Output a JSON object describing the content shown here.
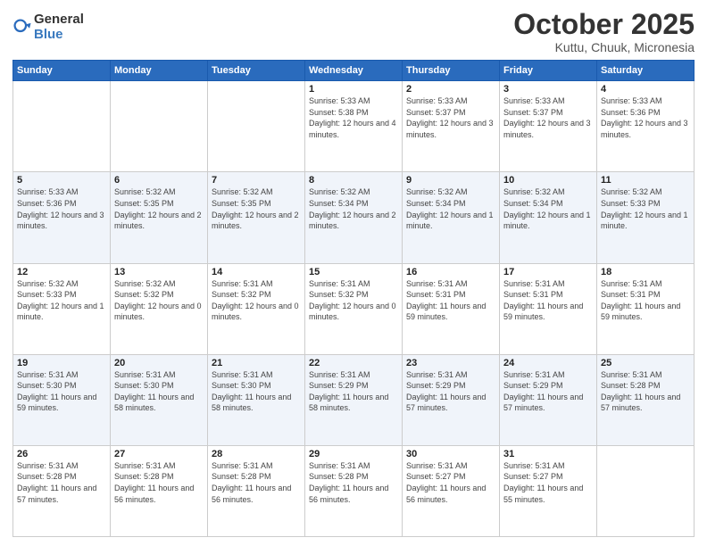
{
  "logo": {
    "general": "General",
    "blue": "Blue"
  },
  "header": {
    "month": "October 2025",
    "location": "Kuttu, Chuuk, Micronesia"
  },
  "weekdays": [
    "Sunday",
    "Monday",
    "Tuesday",
    "Wednesday",
    "Thursday",
    "Friday",
    "Saturday"
  ],
  "weeks": [
    [
      {
        "day": "",
        "sunrise": "",
        "sunset": "",
        "daylight": ""
      },
      {
        "day": "",
        "sunrise": "",
        "sunset": "",
        "daylight": ""
      },
      {
        "day": "",
        "sunrise": "",
        "sunset": "",
        "daylight": ""
      },
      {
        "day": "1",
        "sunrise": "Sunrise: 5:33 AM",
        "sunset": "Sunset: 5:38 PM",
        "daylight": "Daylight: 12 hours and 4 minutes."
      },
      {
        "day": "2",
        "sunrise": "Sunrise: 5:33 AM",
        "sunset": "Sunset: 5:37 PM",
        "daylight": "Daylight: 12 hours and 3 minutes."
      },
      {
        "day": "3",
        "sunrise": "Sunrise: 5:33 AM",
        "sunset": "Sunset: 5:37 PM",
        "daylight": "Daylight: 12 hours and 3 minutes."
      },
      {
        "day": "4",
        "sunrise": "Sunrise: 5:33 AM",
        "sunset": "Sunset: 5:36 PM",
        "daylight": "Daylight: 12 hours and 3 minutes."
      }
    ],
    [
      {
        "day": "5",
        "sunrise": "Sunrise: 5:33 AM",
        "sunset": "Sunset: 5:36 PM",
        "daylight": "Daylight: 12 hours and 3 minutes."
      },
      {
        "day": "6",
        "sunrise": "Sunrise: 5:32 AM",
        "sunset": "Sunset: 5:35 PM",
        "daylight": "Daylight: 12 hours and 2 minutes."
      },
      {
        "day": "7",
        "sunrise": "Sunrise: 5:32 AM",
        "sunset": "Sunset: 5:35 PM",
        "daylight": "Daylight: 12 hours and 2 minutes."
      },
      {
        "day": "8",
        "sunrise": "Sunrise: 5:32 AM",
        "sunset": "Sunset: 5:34 PM",
        "daylight": "Daylight: 12 hours and 2 minutes."
      },
      {
        "day": "9",
        "sunrise": "Sunrise: 5:32 AM",
        "sunset": "Sunset: 5:34 PM",
        "daylight": "Daylight: 12 hours and 1 minute."
      },
      {
        "day": "10",
        "sunrise": "Sunrise: 5:32 AM",
        "sunset": "Sunset: 5:34 PM",
        "daylight": "Daylight: 12 hours and 1 minute."
      },
      {
        "day": "11",
        "sunrise": "Sunrise: 5:32 AM",
        "sunset": "Sunset: 5:33 PM",
        "daylight": "Daylight: 12 hours and 1 minute."
      }
    ],
    [
      {
        "day": "12",
        "sunrise": "Sunrise: 5:32 AM",
        "sunset": "Sunset: 5:33 PM",
        "daylight": "Daylight: 12 hours and 1 minute."
      },
      {
        "day": "13",
        "sunrise": "Sunrise: 5:32 AM",
        "sunset": "Sunset: 5:32 PM",
        "daylight": "Daylight: 12 hours and 0 minutes."
      },
      {
        "day": "14",
        "sunrise": "Sunrise: 5:31 AM",
        "sunset": "Sunset: 5:32 PM",
        "daylight": "Daylight: 12 hours and 0 minutes."
      },
      {
        "day": "15",
        "sunrise": "Sunrise: 5:31 AM",
        "sunset": "Sunset: 5:32 PM",
        "daylight": "Daylight: 12 hours and 0 minutes."
      },
      {
        "day": "16",
        "sunrise": "Sunrise: 5:31 AM",
        "sunset": "Sunset: 5:31 PM",
        "daylight": "Daylight: 11 hours and 59 minutes."
      },
      {
        "day": "17",
        "sunrise": "Sunrise: 5:31 AM",
        "sunset": "Sunset: 5:31 PM",
        "daylight": "Daylight: 11 hours and 59 minutes."
      },
      {
        "day": "18",
        "sunrise": "Sunrise: 5:31 AM",
        "sunset": "Sunset: 5:31 PM",
        "daylight": "Daylight: 11 hours and 59 minutes."
      }
    ],
    [
      {
        "day": "19",
        "sunrise": "Sunrise: 5:31 AM",
        "sunset": "Sunset: 5:30 PM",
        "daylight": "Daylight: 11 hours and 59 minutes."
      },
      {
        "day": "20",
        "sunrise": "Sunrise: 5:31 AM",
        "sunset": "Sunset: 5:30 PM",
        "daylight": "Daylight: 11 hours and 58 minutes."
      },
      {
        "day": "21",
        "sunrise": "Sunrise: 5:31 AM",
        "sunset": "Sunset: 5:30 PM",
        "daylight": "Daylight: 11 hours and 58 minutes."
      },
      {
        "day": "22",
        "sunrise": "Sunrise: 5:31 AM",
        "sunset": "Sunset: 5:29 PM",
        "daylight": "Daylight: 11 hours and 58 minutes."
      },
      {
        "day": "23",
        "sunrise": "Sunrise: 5:31 AM",
        "sunset": "Sunset: 5:29 PM",
        "daylight": "Daylight: 11 hours and 57 minutes."
      },
      {
        "day": "24",
        "sunrise": "Sunrise: 5:31 AM",
        "sunset": "Sunset: 5:29 PM",
        "daylight": "Daylight: 11 hours and 57 minutes."
      },
      {
        "day": "25",
        "sunrise": "Sunrise: 5:31 AM",
        "sunset": "Sunset: 5:28 PM",
        "daylight": "Daylight: 11 hours and 57 minutes."
      }
    ],
    [
      {
        "day": "26",
        "sunrise": "Sunrise: 5:31 AM",
        "sunset": "Sunset: 5:28 PM",
        "daylight": "Daylight: 11 hours and 57 minutes."
      },
      {
        "day": "27",
        "sunrise": "Sunrise: 5:31 AM",
        "sunset": "Sunset: 5:28 PM",
        "daylight": "Daylight: 11 hours and 56 minutes."
      },
      {
        "day": "28",
        "sunrise": "Sunrise: 5:31 AM",
        "sunset": "Sunset: 5:28 PM",
        "daylight": "Daylight: 11 hours and 56 minutes."
      },
      {
        "day": "29",
        "sunrise": "Sunrise: 5:31 AM",
        "sunset": "Sunset: 5:28 PM",
        "daylight": "Daylight: 11 hours and 56 minutes."
      },
      {
        "day": "30",
        "sunrise": "Sunrise: 5:31 AM",
        "sunset": "Sunset: 5:27 PM",
        "daylight": "Daylight: 11 hours and 56 minutes."
      },
      {
        "day": "31",
        "sunrise": "Sunrise: 5:31 AM",
        "sunset": "Sunset: 5:27 PM",
        "daylight": "Daylight: 11 hours and 55 minutes."
      },
      {
        "day": "",
        "sunrise": "",
        "sunset": "",
        "daylight": ""
      }
    ]
  ],
  "rowShading": [
    false,
    true,
    false,
    true,
    false
  ]
}
